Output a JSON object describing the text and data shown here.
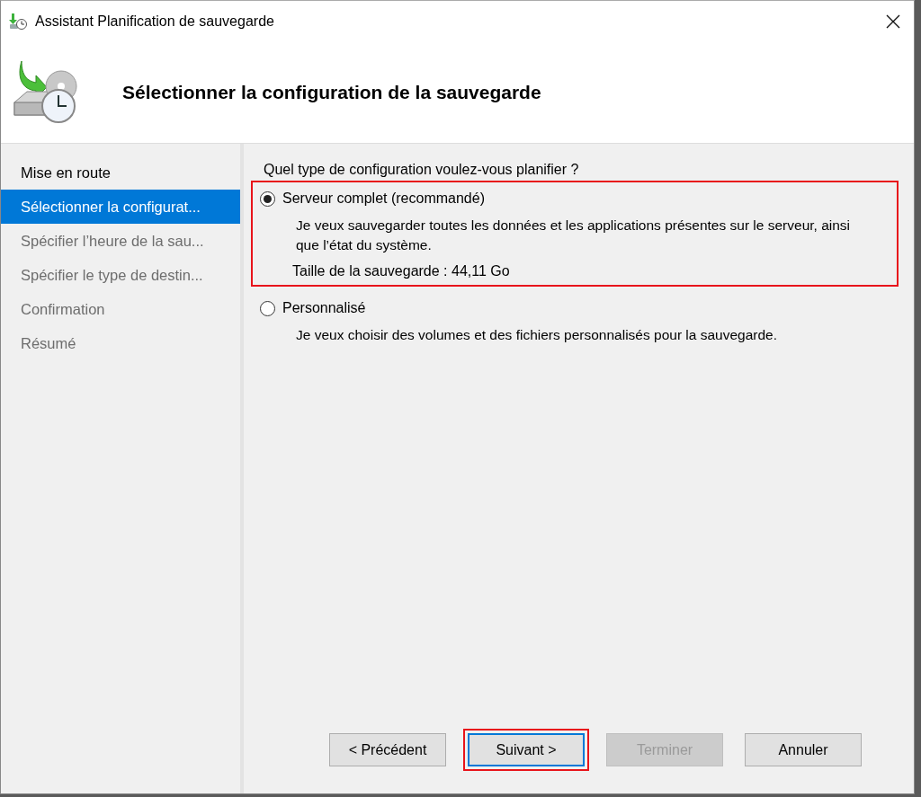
{
  "window": {
    "title": "Assistant Planification de sauvegarde"
  },
  "header": {
    "title": "Sélectionner la configuration de la sauvegarde"
  },
  "steps": [
    {
      "label": "Mise en route",
      "selected": false,
      "disabled": false
    },
    {
      "label": "Sélectionner la configurat...",
      "selected": true,
      "disabled": false
    },
    {
      "label": "Spécifier l’heure de la sau...",
      "selected": false,
      "disabled": true
    },
    {
      "label": "Spécifier le type de destin...",
      "selected": false,
      "disabled": true
    },
    {
      "label": "Confirmation",
      "selected": false,
      "disabled": true
    },
    {
      "label": "Résumé",
      "selected": false,
      "disabled": true
    }
  ],
  "question": "Quel type de configuration voulez-vous planifier ?",
  "options": [
    {
      "label": "Serveur complet (recommandé)",
      "selected": true,
      "highlighted": true,
      "description": "Je veux sauvegarder toutes les données et les applications présentes sur le serveur, ainsi que l’état du système.",
      "size": "Taille de la sauvegarde : 44,11 Go"
    },
    {
      "label": "Personnalisé",
      "selected": false,
      "highlighted": false,
      "description": "Je veux choisir des volumes et des fichiers personnalisés pour la sauvegarde."
    }
  ],
  "buttons": [
    {
      "label": "< Précédent",
      "disabled": false,
      "default": false,
      "highlighted": false
    },
    {
      "label": "Suivant >",
      "disabled": false,
      "default": true,
      "highlighted": true
    },
    {
      "label": "Terminer",
      "disabled": true,
      "default": false,
      "highlighted": false
    },
    {
      "label": "Annuler",
      "disabled": false,
      "default": false,
      "highlighted": false
    }
  ]
}
